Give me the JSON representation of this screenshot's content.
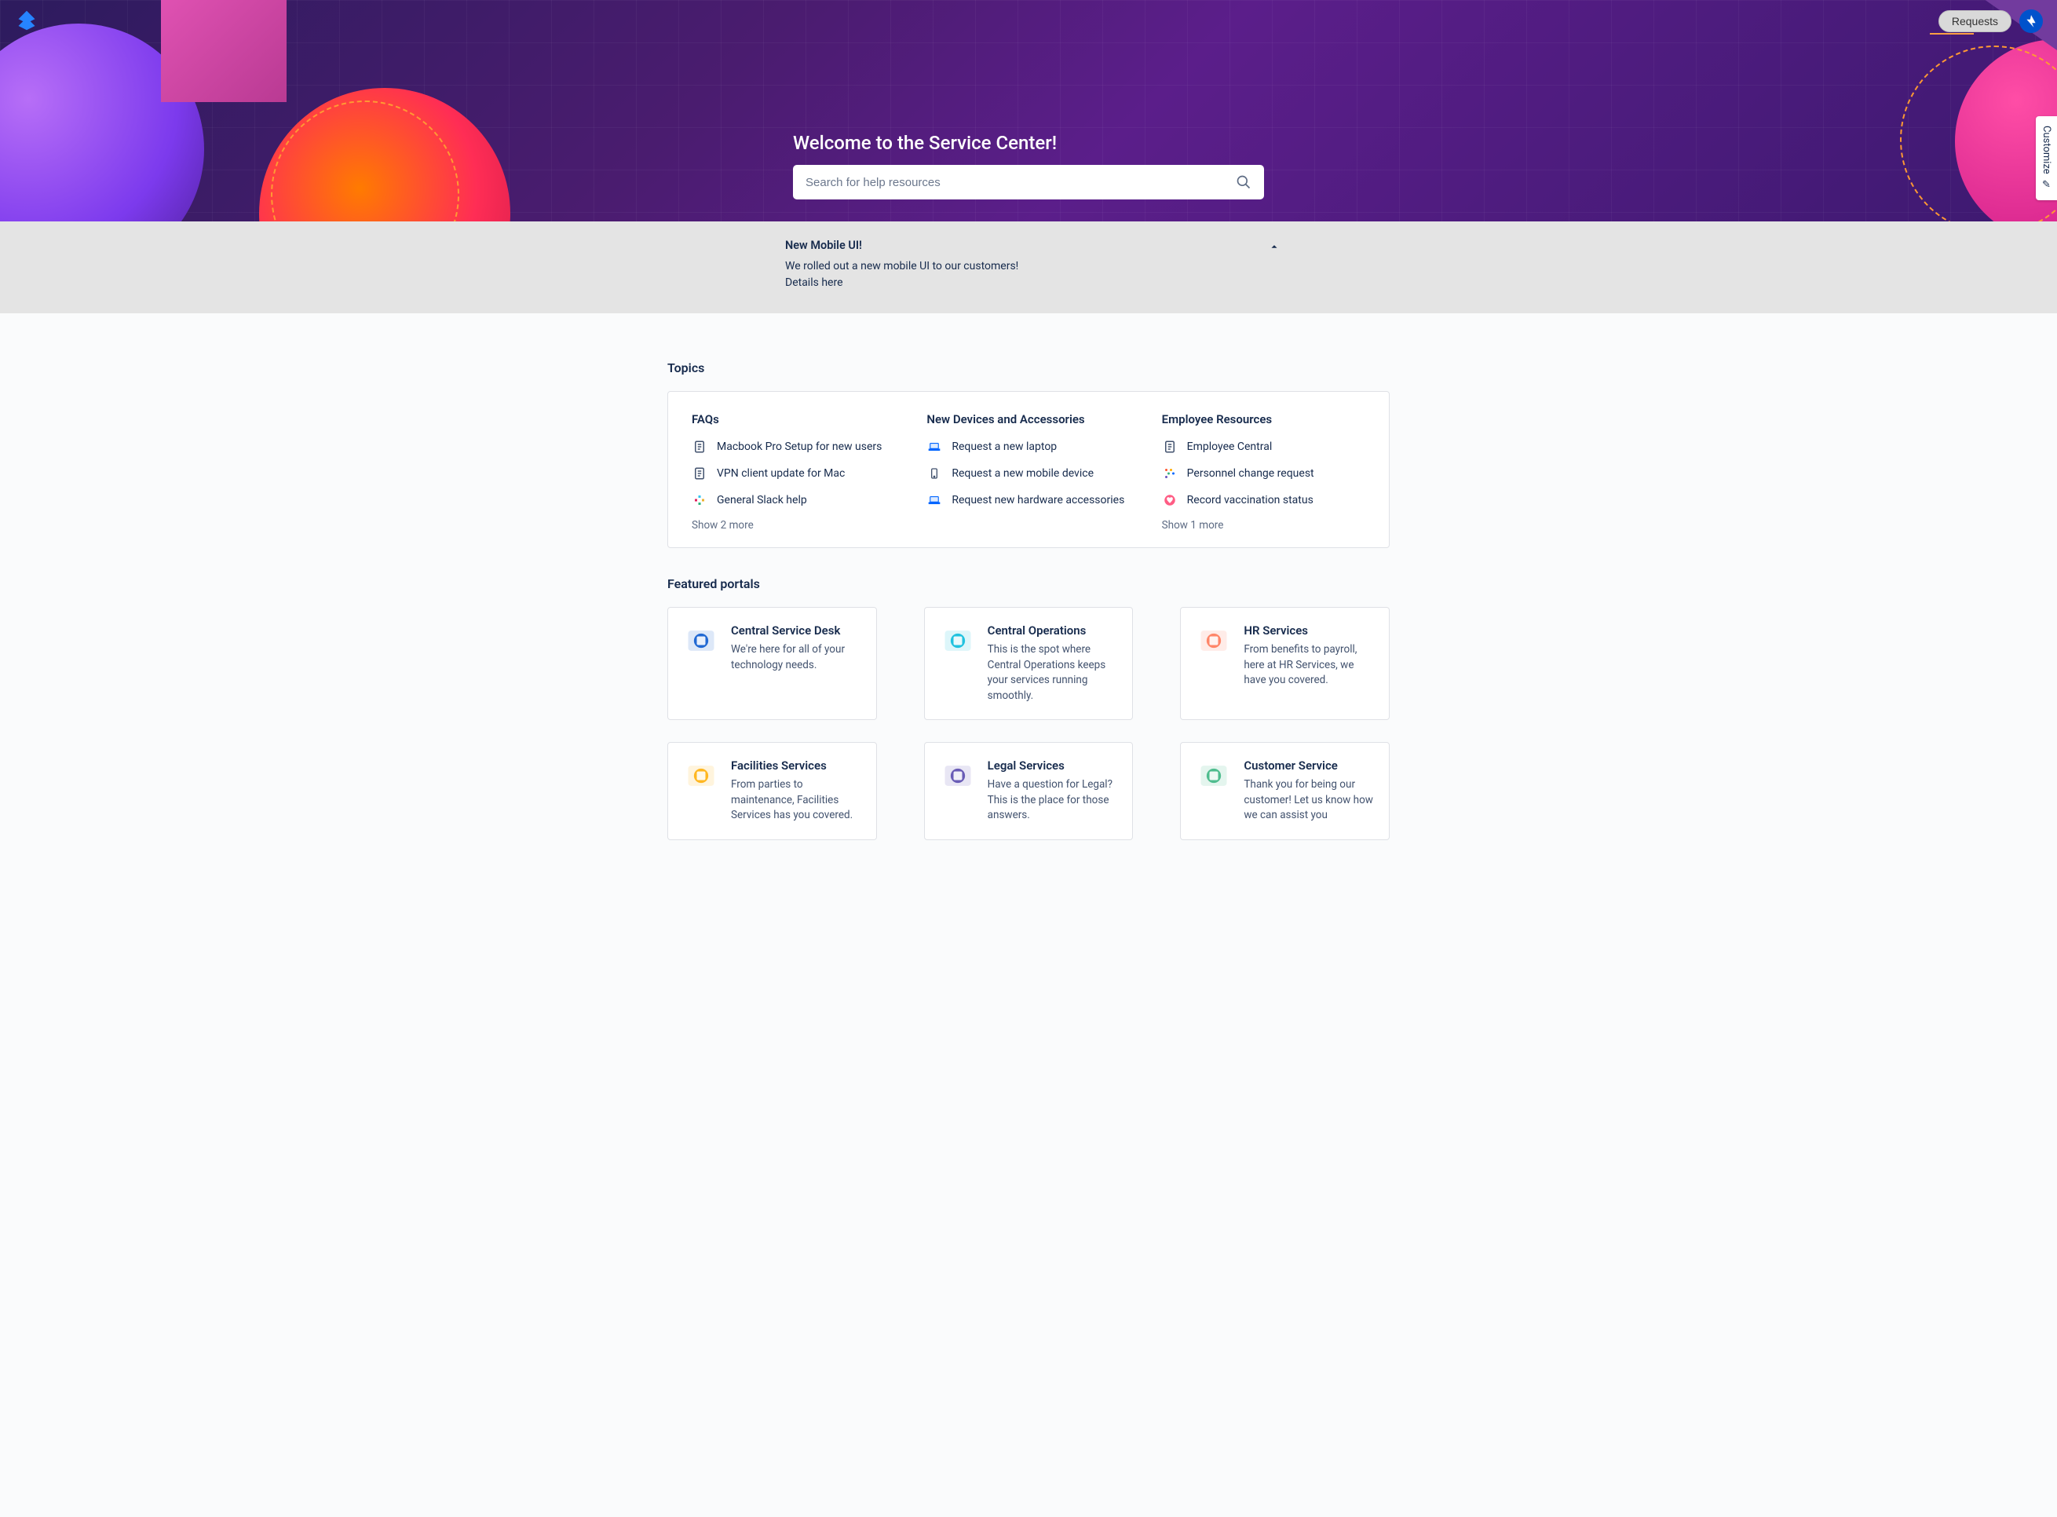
{
  "header": {
    "requests_label": "Requests"
  },
  "customize_label": "Customize",
  "hero": {
    "title": "Welcome to the Service Center!",
    "search_placeholder": "Search for help resources"
  },
  "announcement": {
    "title": "New Mobile UI!",
    "body": "We rolled out a new mobile UI to our customers!",
    "link_text": "Details here"
  },
  "topics": {
    "section_title": "Topics",
    "columns": [
      {
        "title": "FAQs",
        "items": [
          {
            "icon": "document-icon",
            "label": "Macbook Pro Setup for new users"
          },
          {
            "icon": "document-icon",
            "label": "VPN client update for Mac"
          },
          {
            "icon": "slack-icon",
            "label": "General Slack help"
          }
        ],
        "show_more": "Show 2 more"
      },
      {
        "title": "New Devices and Accessories",
        "items": [
          {
            "icon": "laptop-icon",
            "label": "Request a new laptop"
          },
          {
            "icon": "mobile-icon",
            "label": "Request a new mobile device"
          },
          {
            "icon": "laptop-icon",
            "label": "Request new hardware accessories"
          }
        ]
      },
      {
        "title": "Employee Resources",
        "items": [
          {
            "icon": "document-icon",
            "label": "Employee Central"
          },
          {
            "icon": "dots-icon",
            "label": "Personnel change request"
          },
          {
            "icon": "heart-icon",
            "label": "Record vaccination status"
          }
        ],
        "show_more": "Show 1 more"
      }
    ]
  },
  "portals": {
    "section_title": "Featured portals",
    "cards": [
      {
        "title": "Central Service Desk",
        "desc": "We're here for all of your technology needs.",
        "icon": "service-desk-icon",
        "color": "#0052cc"
      },
      {
        "title": "Central Operations",
        "desc": "This is the spot where Central Operations keeps your services running smoothly.",
        "icon": "gear-icon",
        "color": "#00b8d9"
      },
      {
        "title": "HR Services",
        "desc": "From benefits to payroll, here at HR Services, we have you covered.",
        "icon": "hr-icon",
        "color": "#ff7452"
      },
      {
        "title": "Facilities Services",
        "desc": "From parties to maintenance, Facilities Services has you covered.",
        "icon": "facilities-icon",
        "color": "#ffab00"
      },
      {
        "title": "Legal Services",
        "desc": "Have a question for Legal? This is the place for those answers.",
        "icon": "legal-icon",
        "color": "#5243aa"
      },
      {
        "title": "Customer Service",
        "desc": "Thank you for being our customer! Let us know how we can assist you",
        "icon": "customer-icon",
        "color": "#36b37e"
      }
    ]
  }
}
